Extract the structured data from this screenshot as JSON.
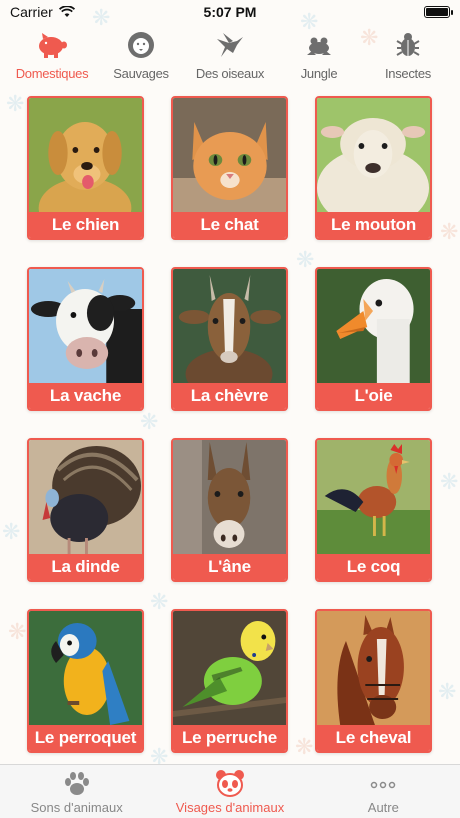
{
  "status_bar": {
    "carrier": "Carrier",
    "time": "5:07 PM"
  },
  "categories": [
    {
      "label": "Domestiques",
      "icon": "pig-icon",
      "active": true
    },
    {
      "label": "Sauvages",
      "icon": "lion-icon",
      "active": false
    },
    {
      "label": "Des oiseaux",
      "icon": "hummingbird-icon",
      "active": false
    },
    {
      "label": "Jungle",
      "icon": "frog-icon",
      "active": false
    },
    {
      "label": "Insectes",
      "icon": "bug-icon",
      "active": false
    }
  ],
  "animals": [
    {
      "label": "Le chien",
      "photo": "dog-photo"
    },
    {
      "label": "Le chat",
      "photo": "cat-photo"
    },
    {
      "label": "Le mouton",
      "photo": "sheep-photo"
    },
    {
      "label": "La vache",
      "photo": "cow-photo"
    },
    {
      "label": "La chèvre",
      "photo": "goat-photo"
    },
    {
      "label": "L'oie",
      "photo": "goose-photo"
    },
    {
      "label": "La dinde",
      "photo": "turkey-photo"
    },
    {
      "label": "L'âne",
      "photo": "donkey-photo"
    },
    {
      "label": "Le coq",
      "photo": "rooster-photo"
    },
    {
      "label": "Le perroquet",
      "photo": "parrot-photo"
    },
    {
      "label": "Le perruche",
      "photo": "budgie-photo"
    },
    {
      "label": "Le cheval",
      "photo": "horse-photo"
    }
  ],
  "tab_bar": {
    "items": [
      {
        "label": "Sons d'animaux",
        "icon": "paw-icon",
        "active": false
      },
      {
        "label": "Visages d'animaux",
        "icon": "panda-icon",
        "active": true
      },
      {
        "label": "Autre",
        "icon": "more-icon",
        "active": false
      }
    ]
  },
  "colors": {
    "accent": "#ef5a4f",
    "inactive": "#888888"
  }
}
